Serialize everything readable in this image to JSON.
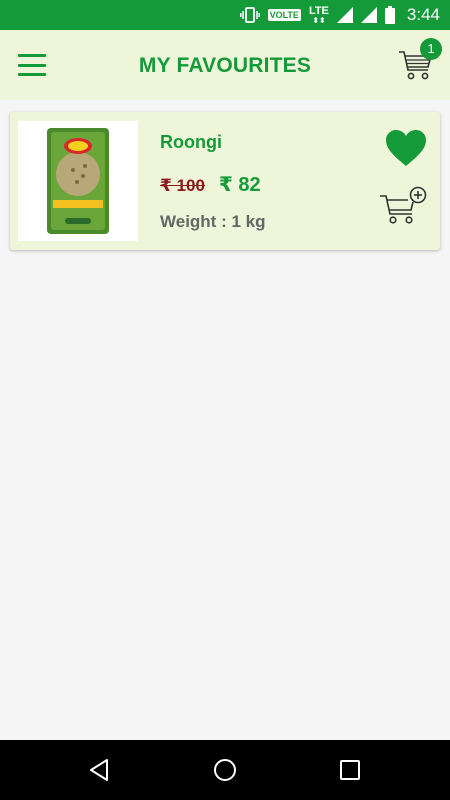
{
  "status_bar": {
    "volte_label": "VOLTE",
    "lte_label": "LTE",
    "time": "3:44",
    "icons": [
      "vibrate-icon",
      "volte-icon",
      "lte-icon",
      "signal-icon",
      "signal-icon",
      "battery-icon"
    ]
  },
  "header": {
    "title": "MY FAVOURITES",
    "menu_icon": "hamburger-menu-icon",
    "cart_icon": "shopping-cart-icon",
    "cart_count": "1"
  },
  "favourites": [
    {
      "name": "Roongi",
      "currency": "₹",
      "old_price": "₹ 100",
      "new_price": "₹ 82",
      "weight": "Weight : 1 kg",
      "fav_icon": "heart-filled-icon",
      "add_to_cart_icon": "cart-add-icon"
    }
  ],
  "nav_bar": {
    "icons": [
      "back-icon",
      "home-icon",
      "recents-icon"
    ]
  },
  "colors": {
    "primary": "#159a3a",
    "header_bg": "#eef5d8",
    "old_price": "#8b1a1a",
    "text_muted": "#666666"
  }
}
